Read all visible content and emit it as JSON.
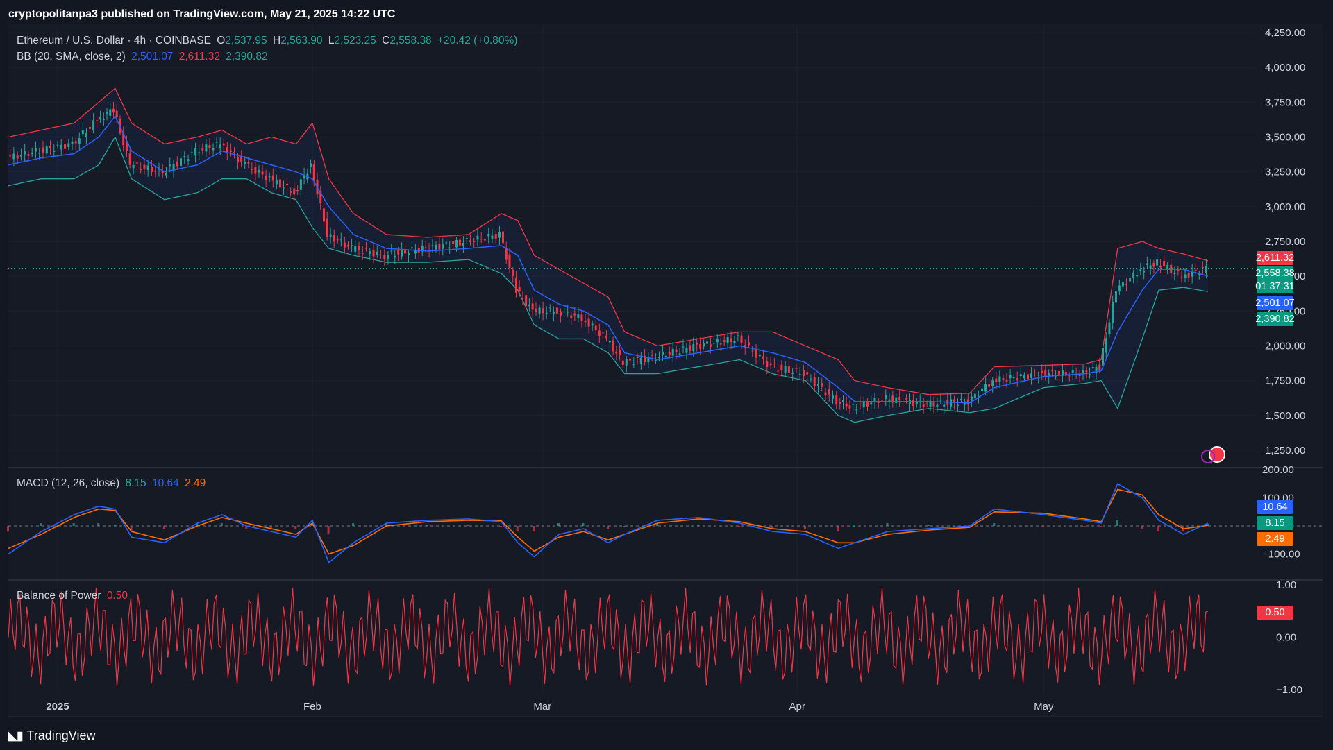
{
  "header": {
    "published": "cryptopolitanpa3 published on TradingView.com, May 21, 2025 14:22 UTC"
  },
  "legend_main": {
    "symbol": "Ethereum / U.S. Dollar · 4h · COINBASE",
    "o_label": "O",
    "o_value": "2,537.95",
    "h_label": "H",
    "h_value": "2,563.90",
    "l_label": "L",
    "l_value": "2,523.25",
    "c_label": "C",
    "c_value": "2,558.38",
    "change": "+20.42 (+0.80%)"
  },
  "legend_bb": {
    "label": "BB (20, SMA, close, 2)",
    "basis": "2,501.07",
    "upper": "2,611.32",
    "lower": "2,390.82"
  },
  "legend_macd": {
    "label": "MACD (12, 26, close)",
    "histogram": "8.15",
    "macd": "10.64",
    "signal": "2.49"
  },
  "legend_bop": {
    "label": "Balance of Power",
    "value": "0.50"
  },
  "price_tags": {
    "upper": "2,611.32",
    "close": "2,558.38",
    "countdown": "01:37:31",
    "basis": "2,501.07",
    "lower": "2,390.82"
  },
  "macd_tags": {
    "macd": "10.64",
    "histogram": "8.15",
    "signal": "2.49"
  },
  "bop_tag": "0.50",
  "brand": {
    "name": "TradingView"
  },
  "colors": {
    "up": "#26a69a",
    "down": "#f23645",
    "basis": "#2962ff",
    "signal": "#ff6d00",
    "bg": "#161a25"
  },
  "chart_data": [
    {
      "type": "line",
      "title": "Ethereum / U.S. Dollar · 4h · COINBASE",
      "x_ticks": [
        "2025",
        "Feb",
        "Mar",
        "Apr",
        "May"
      ],
      "y_ticks": [
        "1,250.00",
        "1,500.00",
        "1,750.00",
        "2,000.00",
        "2,250.00",
        "2,500.00",
        "2,750.00",
        "3,000.00",
        "3,250.00",
        "3,500.00",
        "3,750.00",
        "4,000.00",
        "4,250.00"
      ],
      "ylim": [
        1130,
        4310
      ],
      "x": [
        "2024-12-26",
        "2024-12-30",
        "2025-01-03",
        "2025-01-06",
        "2025-01-08",
        "2025-01-10",
        "2025-01-14",
        "2025-01-18",
        "2025-01-21",
        "2025-01-24",
        "2025-01-27",
        "2025-01-30",
        "2025-02-01",
        "2025-02-03",
        "2025-02-06",
        "2025-02-10",
        "2025-02-15",
        "2025-02-20",
        "2025-02-24",
        "2025-02-26",
        "2025-02-28",
        "2025-03-03",
        "2025-03-06",
        "2025-03-09",
        "2025-03-11",
        "2025-03-15",
        "2025-03-20",
        "2025-03-25",
        "2025-03-29",
        "2025-04-02",
        "2025-04-06",
        "2025-04-08",
        "2025-04-12",
        "2025-04-17",
        "2025-04-22",
        "2025-04-25",
        "2025-05-01",
        "2025-05-06",
        "2025-05-08",
        "2025-05-10",
        "2025-05-13",
        "2025-05-15",
        "2025-05-18",
        "2025-05-21"
      ],
      "series": [
        {
          "name": "",
          "values": [
            3350,
            3400,
            3450,
            3620,
            3700,
            3300,
            3250,
            3400,
            3450,
            3300,
            3200,
            3100,
            3300,
            2800,
            2700,
            2650,
            2700,
            2750,
            2800,
            2400,
            2250,
            2250,
            2200,
            2050,
            1880,
            1920,
            2000,
            2050,
            1850,
            1800,
            1600,
            1560,
            1620,
            1580,
            1600,
            1750,
            1800,
            1800,
            1850,
            2400,
            2550,
            2600,
            2500,
            2558
          ]
        },
        {
          "name": "",
          "values": [
            3300,
            3350,
            3380,
            3500,
            3650,
            3400,
            3250,
            3300,
            3400,
            3350,
            3300,
            3250,
            3200,
            3000,
            2800,
            2700,
            2680,
            2700,
            2720,
            2650,
            2400,
            2300,
            2250,
            2150,
            1950,
            1900,
            1950,
            2000,
            1950,
            1880,
            1700,
            1600,
            1600,
            1600,
            1590,
            1700,
            1780,
            1800,
            1820,
            2100,
            2400,
            2550,
            2550,
            2501
          ]
        },
        {
          "name": "",
          "values": [
            3500,
            3550,
            3600,
            3750,
            3850,
            3600,
            3450,
            3500,
            3550,
            3450,
            3500,
            3450,
            3600,
            3200,
            2950,
            2800,
            2780,
            2800,
            2950,
            2900,
            2650,
            2550,
            2450,
            2350,
            2100,
            2000,
            2050,
            2100,
            2100,
            2000,
            1900,
            1750,
            1700,
            1650,
            1660,
            1850,
            1860,
            1870,
            1900,
            2700,
            2750,
            2700,
            2660,
            2611
          ]
        },
        {
          "name": "",
          "values": [
            3150,
            3200,
            3200,
            3300,
            3500,
            3200,
            3050,
            3100,
            3200,
            3200,
            3100,
            3050,
            2850,
            2700,
            2650,
            2600,
            2600,
            2620,
            2520,
            2400,
            2150,
            2050,
            2050,
            1950,
            1800,
            1800,
            1850,
            1900,
            1800,
            1750,
            1500,
            1450,
            1500,
            1550,
            1520,
            1550,
            1700,
            1730,
            1750,
            1550,
            2050,
            2400,
            2420,
            2390
          ]
        }
      ]
    },
    {
      "type": "line",
      "title": "MACD (12, 26, close)",
      "y_ticks": [
        "−100.00",
        "100.00",
        "200.00"
      ],
      "ylim": [
        -190,
        205
      ],
      "series": [
        {
          "name": "",
          "values": [
            -100,
            -20,
            40,
            70,
            60,
            -40,
            -60,
            10,
            40,
            0,
            -20,
            -40,
            20,
            -130,
            -60,
            10,
            20,
            25,
            15,
            -60,
            -110,
            -30,
            -10,
            -60,
            -30,
            20,
            30,
            10,
            -20,
            -30,
            -80,
            -60,
            -20,
            -10,
            0,
            60,
            40,
            20,
            10,
            150,
            100,
            20,
            -30,
            10
          ]
        },
        {
          "name": "",
          "values": [
            -80,
            -30,
            30,
            60,
            55,
            -20,
            -50,
            0,
            30,
            10,
            -10,
            -30,
            10,
            -100,
            -70,
            0,
            15,
            20,
            18,
            -40,
            -90,
            -40,
            -20,
            -50,
            -30,
            10,
            25,
            15,
            -10,
            -20,
            -60,
            -60,
            -30,
            -15,
            -5,
            50,
            45,
            25,
            15,
            130,
            110,
            40,
            -10,
            2
          ]
        }
      ]
    },
    {
      "type": "line",
      "title": "Balance of Power",
      "y_ticks": [
        "1.00",
        "0.00",
        "−1.00"
      ],
      "ylim": [
        -1.08,
        1.08
      ],
      "series": [
        {
          "name": "",
          "values": [
            0.5
          ]
        }
      ]
    }
  ]
}
